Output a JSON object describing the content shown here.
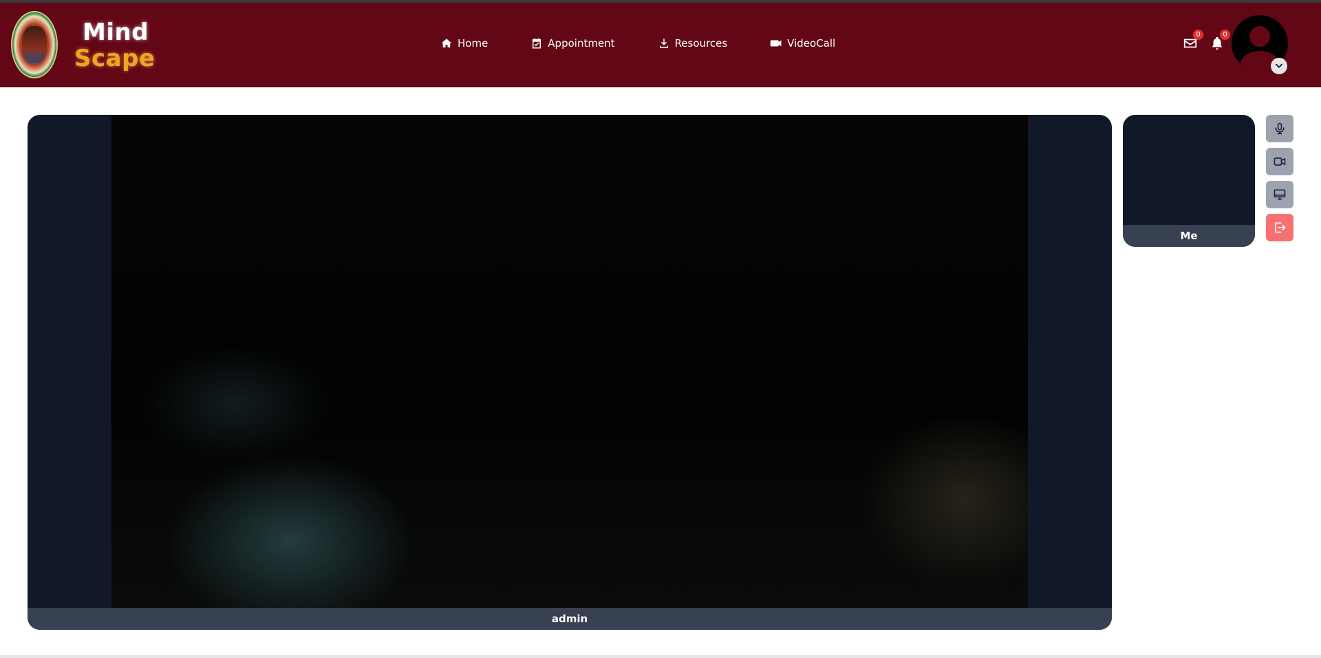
{
  "brand": {
    "line1": "Mind",
    "line2": "Scape"
  },
  "nav": {
    "items": [
      {
        "label": "Home",
        "icon": "home-icon"
      },
      {
        "label": "Appointment",
        "icon": "calendar-check-icon"
      },
      {
        "label": "Resources",
        "icon": "download-icon"
      },
      {
        "label": "VideoCall",
        "icon": "video-camera-icon"
      }
    ]
  },
  "header": {
    "mail_badge": "0",
    "notification_badge": "0"
  },
  "call": {
    "main_participant": "admin",
    "self_label": "Me"
  },
  "controls": [
    {
      "name": "mute",
      "icon": "microphone-icon"
    },
    {
      "name": "camera",
      "icon": "video-camera-icon"
    },
    {
      "name": "share-screen",
      "icon": "monitor-icon"
    },
    {
      "name": "leave",
      "icon": "leave-icon"
    }
  ],
  "colors": {
    "navbar": "#630616",
    "brand_accent": "#f4a422",
    "tile_bg": "#111827",
    "name_bar": "#374151",
    "control_bg": "#9ca3af",
    "leave_bg": "#f87171",
    "badge": "#e0322f"
  }
}
